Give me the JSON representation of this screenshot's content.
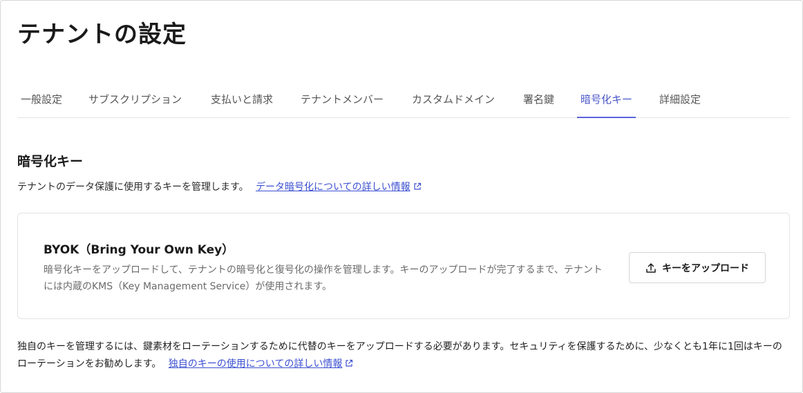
{
  "page": {
    "title": "テナントの設定"
  },
  "tabs": [
    {
      "label": "一般設定"
    },
    {
      "label": "サブスクリプション"
    },
    {
      "label": "支払いと請求"
    },
    {
      "label": "テナントメンバー"
    },
    {
      "label": "カスタムドメイン"
    },
    {
      "label": "署名鍵"
    },
    {
      "label": "暗号化キー"
    },
    {
      "label": "詳細設定"
    }
  ],
  "active_tab": "暗号化キー",
  "section": {
    "title": "暗号化キー",
    "description": "テナントのデータ保護に使用するキーを管理します。",
    "link": "データ暗号化についての詳しい情報"
  },
  "card": {
    "title": "BYOK（Bring Your Own Key）",
    "description": "暗号化キーをアップロードして、テナントの暗号化と復号化の操作を管理します。キーのアップロードが完了するまで、テナントには内蔵のKMS（Key Management Service）が使用されます。",
    "button_label": "キーをアップロード",
    "button_icon": "upload-icon"
  },
  "footer": {
    "text": "独自のキーを管理するには、鍵素材をローテーションするために代替のキーをアップロードする必要があります。セキュリティを保護するために、少なくとも1年に1回はキーのローテーションをお勧めします。",
    "link": "独自のキーの使用についての詳しい情報"
  },
  "colors": {
    "accent": "#4a56c9",
    "link": "#3b4fd1",
    "muted_text": "#6b6b6b"
  }
}
